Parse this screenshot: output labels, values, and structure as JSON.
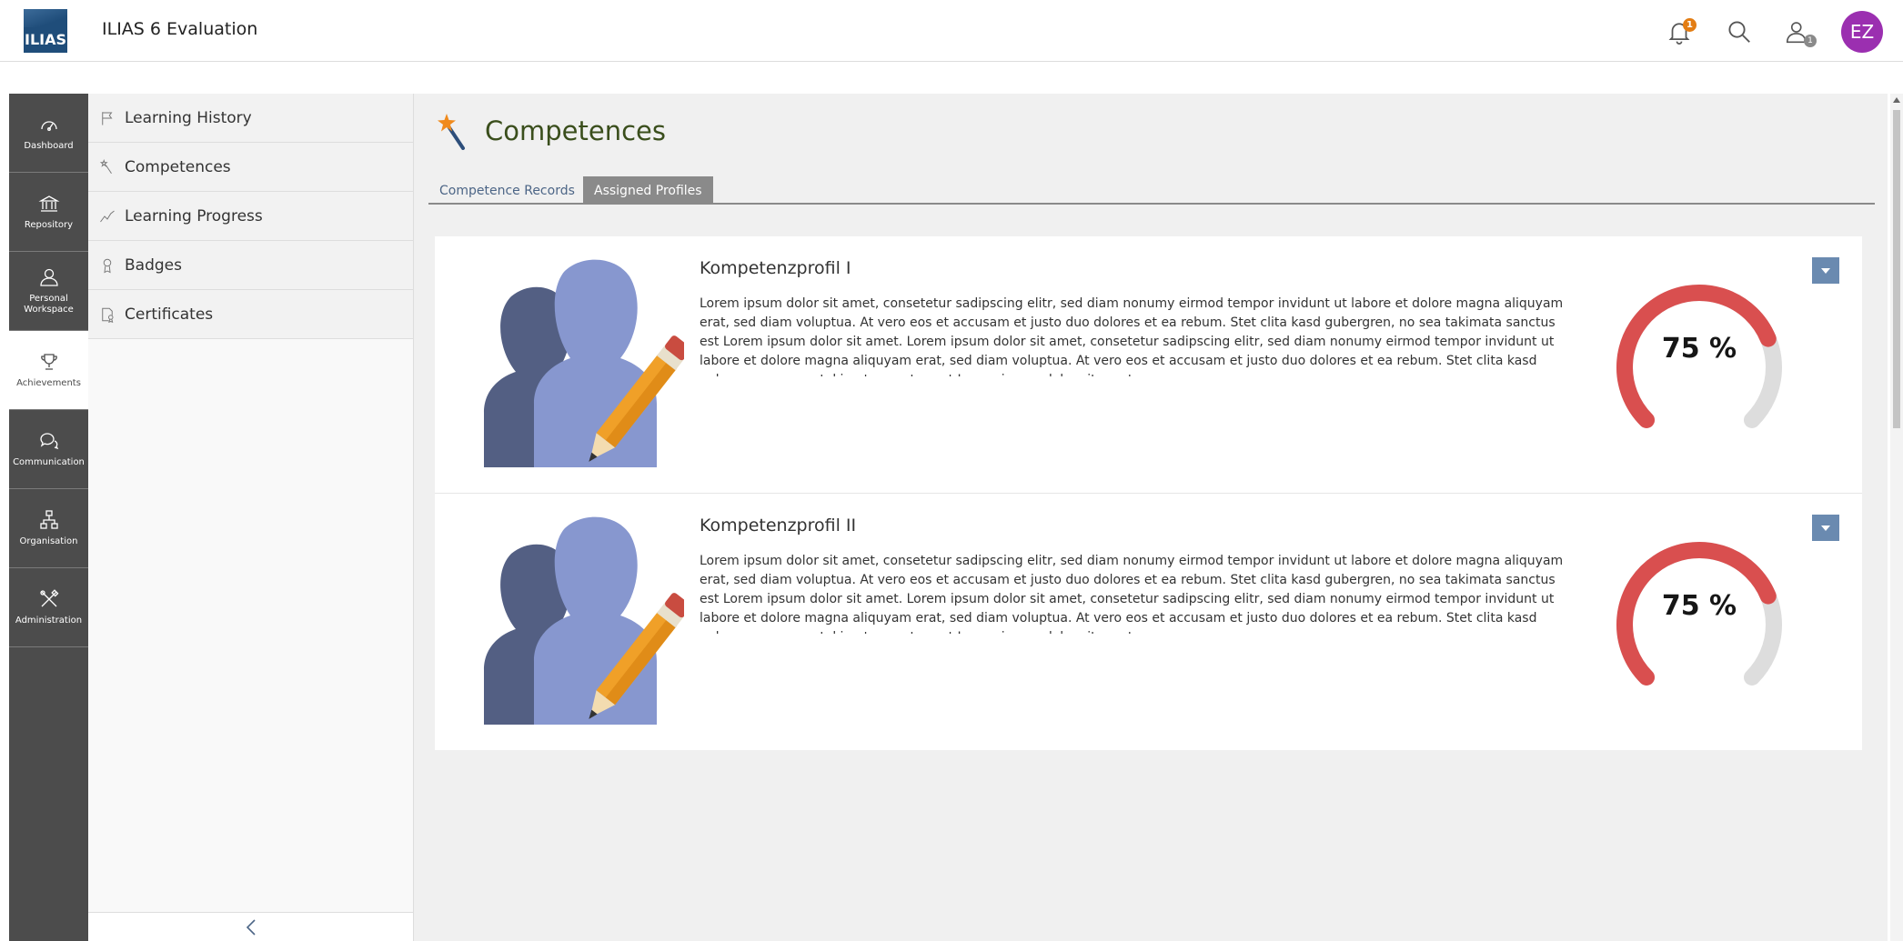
{
  "header": {
    "logo_text": "ILIAS",
    "title": "ILIAS 6 Evaluation",
    "notification_count": "1",
    "online_users_count": "1",
    "avatar_initials": "EZ"
  },
  "mainbar": {
    "items": [
      {
        "label": "Dashboard",
        "icon": "dashboard-icon"
      },
      {
        "label": "Repository",
        "icon": "repository-icon"
      },
      {
        "label": "Personal Workspace",
        "icon": "personal-workspace-icon"
      },
      {
        "label": "Achievements",
        "icon": "trophy-icon"
      },
      {
        "label": "Communication",
        "icon": "communication-icon"
      },
      {
        "label": "Organisation",
        "icon": "organisation-icon"
      },
      {
        "label": "Administration",
        "icon": "administration-icon"
      }
    ]
  },
  "slate": {
    "items": [
      {
        "label": "Learning History",
        "icon": "flag-icon"
      },
      {
        "label": "Competences",
        "icon": "wand-icon"
      },
      {
        "label": "Learning Progress",
        "icon": "chart-line-icon"
      },
      {
        "label": "Badges",
        "icon": "badge-icon"
      },
      {
        "label": "Certificates",
        "icon": "certificate-icon"
      }
    ]
  },
  "main": {
    "title": "Competences",
    "tabs": [
      {
        "label": "Competence Records",
        "active": false
      },
      {
        "label": "Assigned Profiles",
        "active": true
      }
    ],
    "profiles": [
      {
        "title": "Kompetenzprofil I",
        "description": "Lorem ipsum dolor sit amet, consetetur sadipscing elitr, sed diam nonumy eirmod tempor invidunt ut labore et dolore magna aliquyam erat, sed diam voluptua. At vero eos et accusam et justo duo dolores et ea rebum. Stet clita kasd gubergren, no sea takimata sanctus est Lorem ipsum dolor sit amet. Lorem ipsum dolor sit amet, consetetur sadipscing elitr, sed diam nonumy eirmod tempor invidunt ut labore et dolore magna aliquyam erat, sed diam voluptua. At vero eos et accusam et justo duo dolores et ea rebum. Stet clita kasd gubergren, no sea takimata sanctus est Lorem ipsum dolor sit amet.",
        "progress_percent": 75,
        "progress_label": "75 %"
      },
      {
        "title": "Kompetenzprofil II",
        "description": "Lorem ipsum dolor sit amet, consetetur sadipscing elitr, sed diam nonumy eirmod tempor invidunt ut labore et dolore magna aliquyam erat, sed diam voluptua. At vero eos et accusam et justo duo dolores et ea rebum. Stet clita kasd gubergren, no sea takimata sanctus est Lorem ipsum dolor sit amet. Lorem ipsum dolor sit amet, consetetur sadipscing elitr, sed diam nonumy eirmod tempor invidunt ut labore et dolore magna aliquyam erat, sed diam voluptua. At vero eos et accusam et justo duo dolores et ea rebum. Stet clita kasd gubergren, no sea takimata sanctus est Lorem ipsum dolor sit amet.",
        "progress_percent": 75,
        "progress_label": "75 %"
      }
    ]
  },
  "colors": {
    "gauge_fill": "#d94f4f",
    "gauge_track": "#dddddd",
    "mainbar_bg": "#4c4c4c",
    "title_green": "#3a4e1c",
    "dropdown_bg": "#6a8ab0",
    "notification_badge": "#e37d13",
    "avatar_bg": "#9b2fb0"
  }
}
